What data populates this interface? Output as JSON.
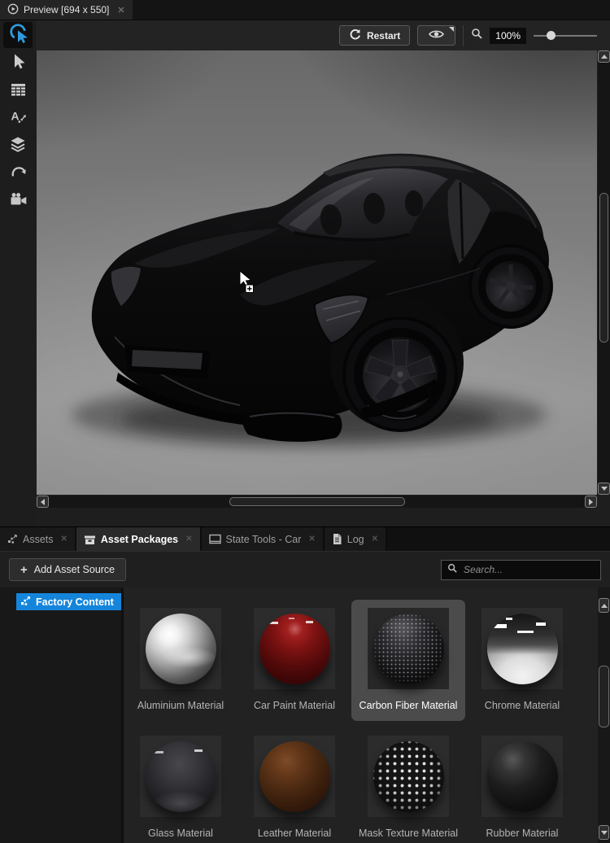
{
  "window": {
    "tab_title": "Preview [694 x 550]"
  },
  "glyphs": {
    "close": "✕",
    "plus": "+"
  },
  "preview_toolbar": {
    "restart_label": "Restart",
    "zoom_value": "100%",
    "zoom_slider_fraction": 0.27
  },
  "tools": [
    {
      "name": "pick-tool",
      "active": true
    },
    {
      "name": "select-tool",
      "active": false
    },
    {
      "name": "table-view-tool",
      "active": false
    },
    {
      "name": "text-tool",
      "active": false
    },
    {
      "name": "layers-tool",
      "active": false
    },
    {
      "name": "connections-tool",
      "active": false
    },
    {
      "name": "camera-tool",
      "active": false
    }
  ],
  "bottom_tabs": [
    {
      "label": "Assets",
      "icon": "assets-icon",
      "active": false
    },
    {
      "label": "Asset Packages",
      "icon": "package-icon",
      "active": true
    },
    {
      "label": "State Tools - Car",
      "icon": "window-icon",
      "active": false
    },
    {
      "label": "Log",
      "icon": "log-icon",
      "active": false
    }
  ],
  "asset_toolbar": {
    "add_button_label": "Add Asset Source",
    "search_placeholder": "Search..."
  },
  "asset_tree": {
    "items": [
      {
        "label": "Factory Content",
        "selected": true
      }
    ]
  },
  "materials": [
    {
      "name": "Aluminium Material",
      "type": "aluminium",
      "selected": false
    },
    {
      "name": "Car Paint Material",
      "type": "carpaint",
      "selected": false
    },
    {
      "name": "Carbon Fiber Material",
      "type": "carbonfiber",
      "selected": true
    },
    {
      "name": "Chrome Material",
      "type": "chrome",
      "selected": false
    },
    {
      "name": "Glass Material",
      "type": "glass",
      "selected": false
    },
    {
      "name": "Leather Material",
      "type": "leather",
      "selected": false
    },
    {
      "name": "Mask Texture Material",
      "type": "masktexture",
      "selected": false
    },
    {
      "name": "Rubber Material",
      "type": "rubber",
      "selected": false
    }
  ],
  "colors": {
    "accent_blue": "#1585dc",
    "tool_active_blue": "#2f9bdf",
    "selection_gray": "#4b4b4b"
  }
}
